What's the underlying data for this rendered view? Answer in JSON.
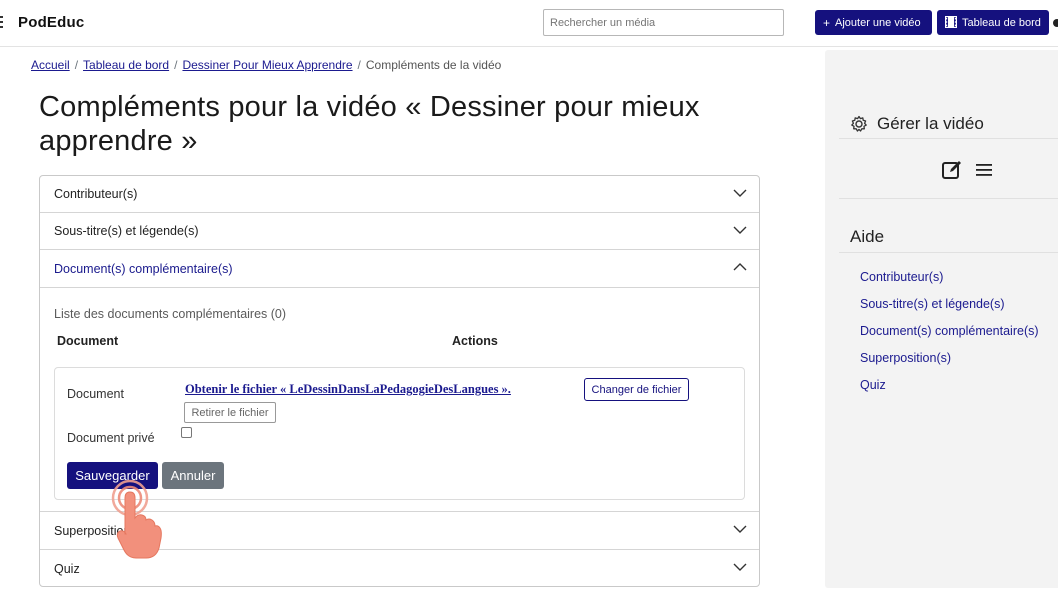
{
  "header": {
    "brand": "PodEduc",
    "search_placeholder": "Rechercher un média",
    "add_video_label": "Ajouter une vidéo",
    "dashboard_label": "Tableau de bord"
  },
  "breadcrumb": {
    "items": [
      "Accueil",
      "Tableau de bord",
      "Dessiner Pour Mieux Apprendre"
    ],
    "current": "Compléments de la vidéo"
  },
  "page_title": "Compléments pour la vidéo « Dessiner pour mieux apprendre »",
  "accordion": {
    "sections": [
      "Contributeur(s)",
      "Sous-titre(s) et légende(s)",
      "Document(s) complémentaire(s)",
      "Superposition(s)",
      "Quiz"
    ],
    "open_section": "Document(s) complémentaire(s)",
    "documents": {
      "list_title": "Liste des documents complémentaires (0)",
      "col_document": "Document",
      "col_actions": "Actions",
      "form": {
        "document_label": "Document",
        "file_link": "Obtenir le fichier « LeDessinDansLaPedagogieDesLangues ».",
        "change_file": "Changer de fichier",
        "remove_file": "Retirer le fichier",
        "private_label": "Document privé",
        "private_checked": false,
        "save": "Sauvegarder",
        "cancel": "Annuler"
      }
    }
  },
  "sidebar": {
    "manage_title": "Gérer la vidéo",
    "help_title": "Aide",
    "help_links": [
      "Contributeur(s)",
      "Sous-titre(s) et légende(s)",
      "Document(s) complémentaire(s)",
      "Superposition(s)",
      "Quiz"
    ]
  },
  "colors": {
    "primary": "#15117e",
    "link": "#1b1a8f",
    "secondary": "#6c757d",
    "sidebar_bg": "#f3f3f3"
  }
}
